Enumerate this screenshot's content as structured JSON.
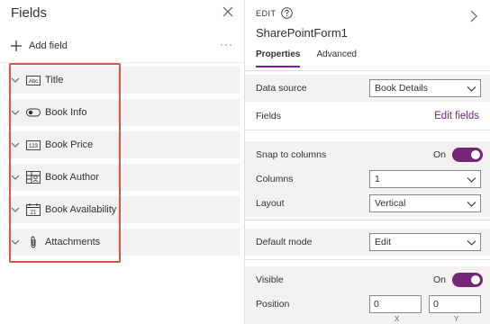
{
  "left_panel": {
    "title": "Fields",
    "add_field_label": "Add field",
    "more_label": "···",
    "fields": [
      {
        "label": "Title",
        "icon": "abc-text-icon"
      },
      {
        "label": "Book Info",
        "icon": "toggle-field-icon"
      },
      {
        "label": "Book Price",
        "icon": "number-123-icon"
      },
      {
        "label": "Book Author",
        "icon": "person-grid-icon"
      },
      {
        "label": "Book Availability",
        "icon": "calendar-21-icon"
      },
      {
        "label": "Attachments",
        "icon": "paperclip-icon"
      }
    ],
    "field_icon_text": {
      "abc": "Abc",
      "num": "123",
      "cal": "21"
    }
  },
  "right_panel": {
    "edit_label": "EDIT",
    "form_name": "SharePointForm1",
    "tabs": [
      {
        "label": "Properties",
        "active": true
      },
      {
        "label": "Advanced",
        "active": false
      }
    ],
    "data_source": {
      "label": "Data source",
      "value": "Book Details"
    },
    "fields": {
      "label": "Fields",
      "link": "Edit fields"
    },
    "snap_to_columns": {
      "label": "Snap to columns",
      "state": "On"
    },
    "columns": {
      "label": "Columns",
      "value": "1"
    },
    "layout": {
      "label": "Layout",
      "value": "Vertical"
    },
    "default_mode": {
      "label": "Default mode",
      "value": "Edit"
    },
    "visible": {
      "label": "Visible",
      "state": "On"
    },
    "position": {
      "label": "Position",
      "x": "0",
      "y": "0",
      "x_axis": "X",
      "y_axis": "Y"
    }
  },
  "colors": {
    "accent": "#742774",
    "highlight_border": "#d9534f",
    "field_bg": "#f3f2f1"
  }
}
